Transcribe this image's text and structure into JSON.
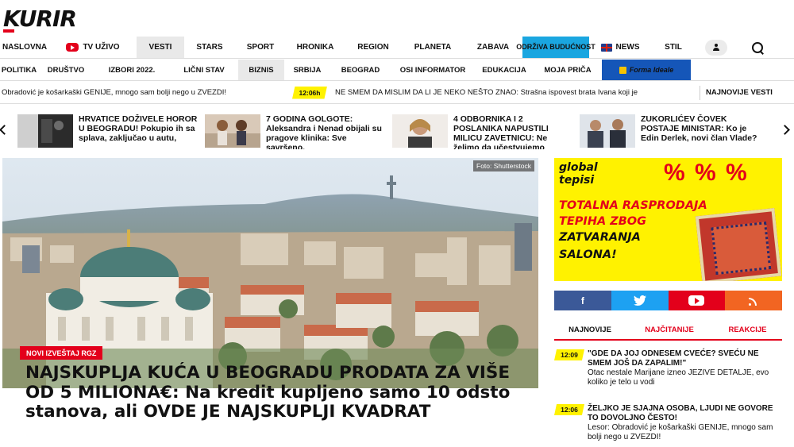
{
  "brand": {
    "logo_text": "KURIR",
    "accent": "#e3001b"
  },
  "main_nav": {
    "items": [
      "NASLOVNA",
      "TV UŽIVO",
      "VESTI",
      "STARS",
      "SPORT",
      "HRONIKA",
      "REGION",
      "PLANETA",
      "ZABAVA"
    ],
    "odrziva": "ODRŽIVA BUDUĆNOST",
    "news_en": "NEWS",
    "stil": "STIL",
    "active": "VESTI"
  },
  "sub_nav": {
    "items": [
      "POLITIKA",
      "DRUŠTVO",
      "IZBORI 2022.",
      "LIČNI STAV",
      "BIZNIS",
      "SRBIJA",
      "BEOGRAD",
      "OSI INFORMATOR",
      "EDUKACIJA",
      "MOJA PRIČA"
    ],
    "forma": "Forma Ideale",
    "active": "BIZNIS"
  },
  "ticker": {
    "prev_text": "Obradović je košarkaški GENIJE, mnogo sam bolji nego u ZVEZDI!",
    "time": "12:06h",
    "text": "NE SMEM DA MISLIM DA LI JE NEKO NEŠTO ZNAO: Strašna ispovest brata Ivana koji je",
    "latest_label": "NAJNOVIJE VESTI"
  },
  "strip": [
    {
      "text": "HRVATICE DOŽIVELE HOROR U BEOGRADU! Pokupio ih sa splava, zaključao u autu,"
    },
    {
      "text": "7 GODINA GOLGOTE: Aleksandra i Nenad obijali su pragove klinika: Sve savršeno,"
    },
    {
      "text": "4 ODBORNIKA I 2 POSLANIKA NAPUSTILI MILICU ZAVETNICU: Ne želimo da učestvujemo"
    },
    {
      "text": "ZUKORLIĆEV ČOVEK POSTAJE MINISTAR: Ko je Edin Derlek, novi član Vlade?"
    }
  ],
  "hero": {
    "credit": "Foto: Shutterstock",
    "tag": "NOVI IZVEŠTAJ RGZ",
    "title": "NAJSKUPLJA KUĆA U BEOGRADU PRODATA ZA VIŠE OD 5 MILIONA€: Na kredit kupljeno samo 10 odsto stanova, ali OVDE JE NAJSKUPLJI KVADRAT"
  },
  "ad": {
    "brand_line1": "global",
    "brand_line2": "tepisi",
    "percent": "% % %",
    "line1": "TOTALNA RASPRODAJA",
    "line2": "TEPIHA ZBOG",
    "line3": "ZATVARANJA",
    "line4": "SALONA!"
  },
  "social": {
    "icons": [
      "facebook-icon",
      "twitter-icon",
      "youtube-icon",
      "rss-icon"
    ],
    "fb_glyph": "f"
  },
  "tabs": [
    "NAJNOVIJE",
    "NAJČITANIJE",
    "REAKCIJE"
  ],
  "news": [
    {
      "time": "12:09",
      "head": "\"GDE DA JOJ ODNESEM CVEĆE? SVEĆU NE SMEM JOŠ DA ZAPALIM!\"",
      "sub": "Otac nestale Marijane izneo JEZIVE DETALJE, evo koliko je telo u vodi"
    },
    {
      "time": "12:06",
      "head": "ŽELJKO JE SJAJNA OSOBA, LJUDI NE GOVORE TO DOVOLJNO ČESTO!",
      "sub": "Lesor: Obradović je košarkaški GENIJE, mnogo sam bolji nego u ZVEZDI!"
    }
  ]
}
